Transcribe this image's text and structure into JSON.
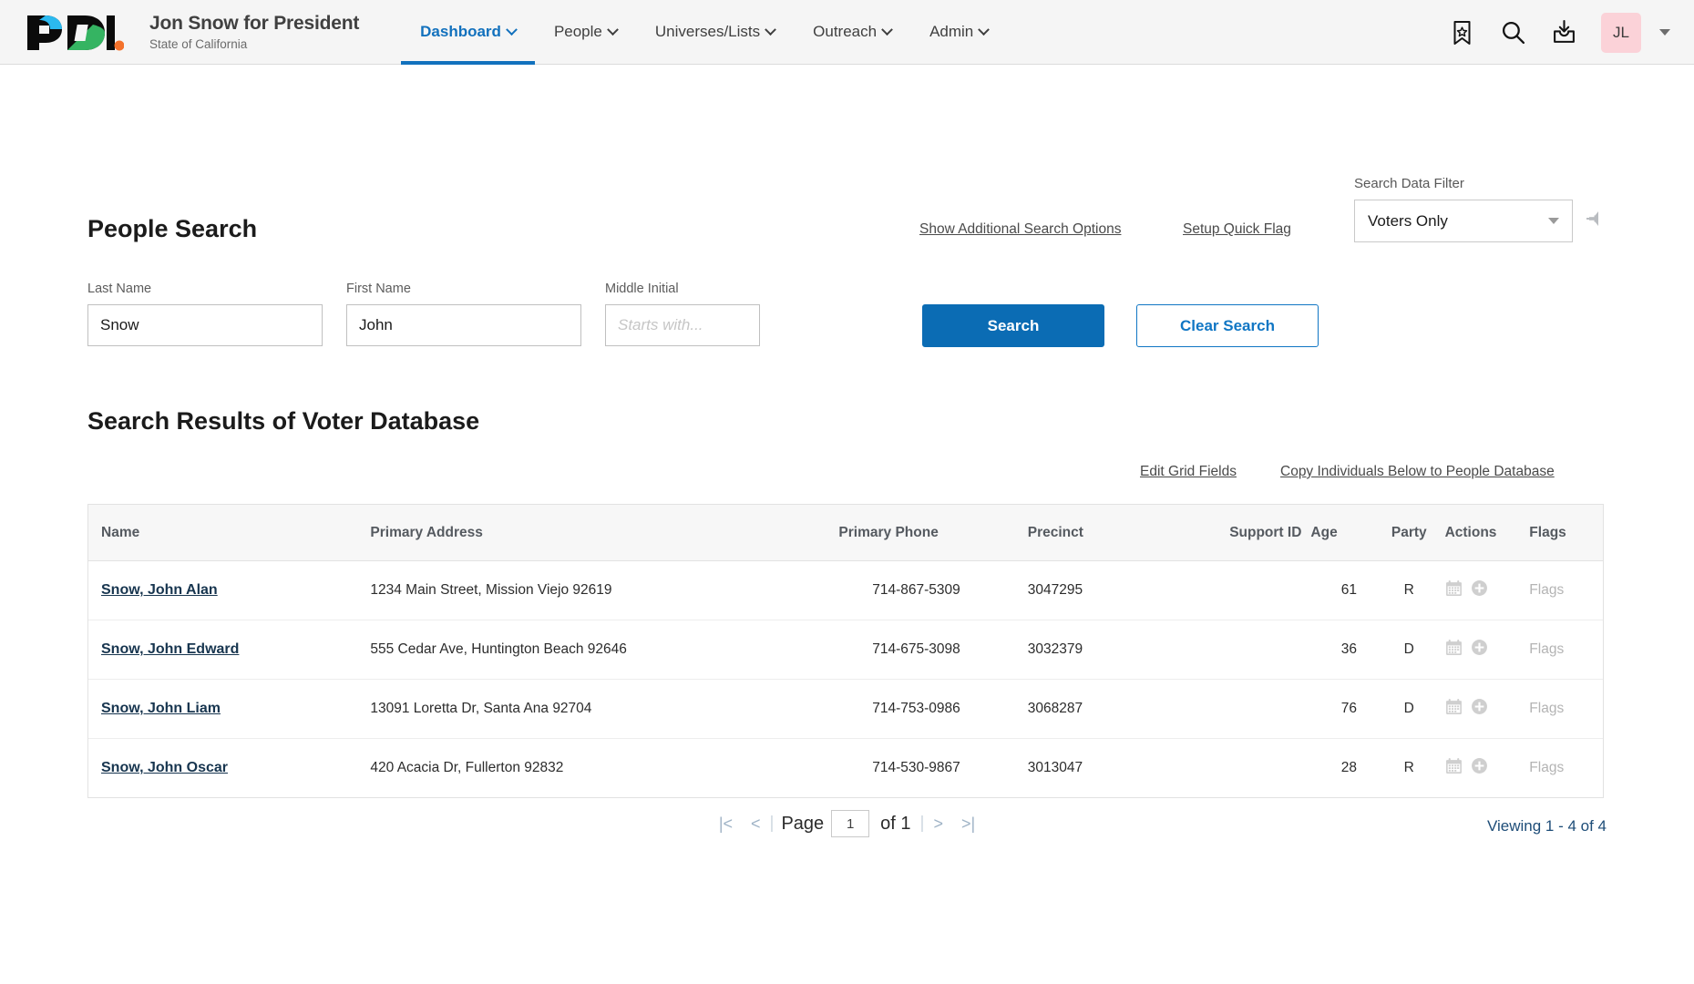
{
  "header": {
    "logo": {
      "name": "pdi-logo",
      "text": "PDI."
    },
    "brand_title": "Jon Snow for President",
    "brand_subtitle": "State of California",
    "nav": [
      {
        "label": "Dashboard",
        "active": true,
        "icon": "chevron-down-icon"
      },
      {
        "label": "People",
        "active": false,
        "icon": "chevron-down-icon"
      },
      {
        "label": "Universes/Lists",
        "active": false,
        "icon": "chevron-down-icon"
      },
      {
        "label": "Outreach",
        "active": false,
        "icon": "chevron-down-icon"
      },
      {
        "label": "Admin",
        "active": false,
        "icon": "chevron-down-icon"
      }
    ],
    "icons": [
      {
        "name": "bookmark-star-icon"
      },
      {
        "name": "search-icon"
      },
      {
        "name": "inbox-download-icon"
      }
    ],
    "avatar_initials": "JL",
    "avatar_bg": "#fbd2d8",
    "accent_color": "#1271bd"
  },
  "search": {
    "title": "People Search",
    "show_additional_options": "Show Additional Search Options",
    "setup_quick_flag": "Setup Quick Flag",
    "data_filter_label": "Search Data Filter",
    "data_filter_value": "Voters Only",
    "pin_icon": "push-pin-icon",
    "fields": [
      {
        "label": "Last Name",
        "value": "Snow",
        "placeholder": ""
      },
      {
        "label": "First Name",
        "value": "John",
        "placeholder": ""
      },
      {
        "label": "Middle Initial",
        "value": "",
        "placeholder": "Starts with..."
      }
    ],
    "search_button": "Search",
    "clear_button": "Clear Search",
    "primary_color": "#0b6cb4"
  },
  "results": {
    "title": "Search Results of Voter Database",
    "edit_grid_fields": "Edit Grid Fields",
    "copy_individuals": "Copy Individuals Below to People Database",
    "columns": [
      "Name",
      "Primary Address",
      "Primary Phone",
      "Precinct",
      "Support ID",
      "Age",
      "Party",
      "Actions",
      "Flags"
    ],
    "rows": [
      {
        "name": "Snow, John  Alan",
        "address": "1234 Main Street, Mission Viejo  92619",
        "phone": "714-867-5309",
        "precinct": "3047295",
        "support_id": "",
        "age": "61",
        "party": "R",
        "flags": "Flags"
      },
      {
        "name": "Snow, John  Edward",
        "address": "555 Cedar Ave, Huntington Beach 92646",
        "phone": "714-675-3098",
        "precinct": "3032379",
        "support_id": "",
        "age": "36",
        "party": "D",
        "flags": "Flags"
      },
      {
        "name": "Snow, John  Liam",
        "address": "13091 Loretta Dr, Santa Ana  92704",
        "phone": "714-753-0986",
        "precinct": "3068287",
        "support_id": "",
        "age": "76",
        "party": "D",
        "flags": "Flags"
      },
      {
        "name": "Snow, John  Oscar",
        "address": "420 Acacia Dr, Fullerton  92832",
        "phone": "714-530-9867",
        "precinct": "3013047",
        "support_id": "",
        "age": "28",
        "party": "R",
        "flags": "Flags"
      }
    ],
    "row_action_icons": [
      "calendar-icon",
      "plus-circle-icon"
    ]
  },
  "pagination": {
    "first": "|<",
    "prev": "<",
    "page_label": "Page",
    "page_value": "1",
    "of_label": "of 1",
    "next": ">",
    "last": ">|",
    "viewing": "Viewing 1 - 4 of 4"
  }
}
